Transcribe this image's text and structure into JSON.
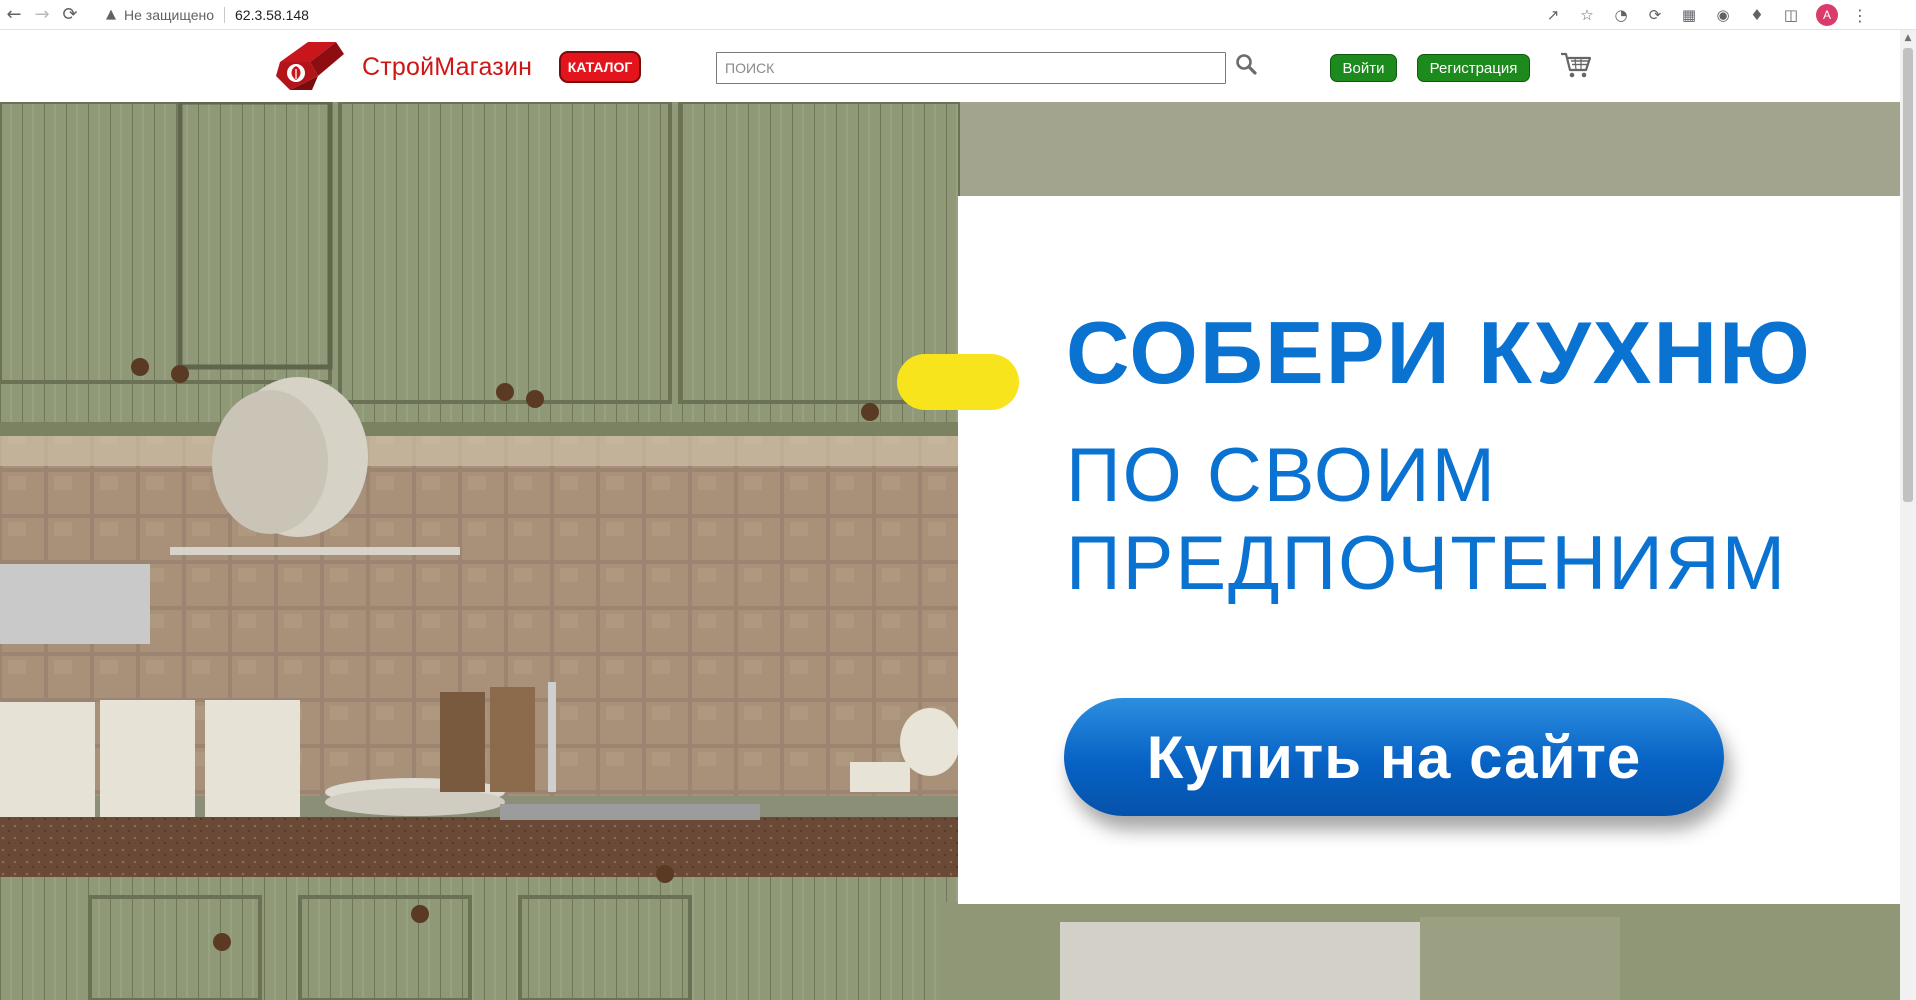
{
  "browser": {
    "back_icon": "arrow-left-icon",
    "forward_icon": "arrow-right-icon",
    "reload_icon": "reload-icon",
    "security_text": "Не защищено",
    "url": "62.3.58.148",
    "profile_initial": "A"
  },
  "header": {
    "brand": "СтройМагазин",
    "catalog_label": "КАТАЛОГ",
    "search_placeholder": "ПОИСК",
    "login_label": "Войти",
    "register_label": "Регистрация"
  },
  "banner": {
    "title": "СОБЕРИ КУХНЮ",
    "subtitle_line1": "ПО СВОИМ",
    "subtitle_line2": "ПРЕДПОЧТЕНИЯМ",
    "button_label": "Купить на сайте",
    "colors": {
      "text": "#0a72d0",
      "button": "#0762c4",
      "pill": "#f8e41c"
    }
  },
  "colors": {
    "brand_red": "#d01515",
    "catalog_red": "#e3141c",
    "auth_green": "#1d8a1d"
  }
}
